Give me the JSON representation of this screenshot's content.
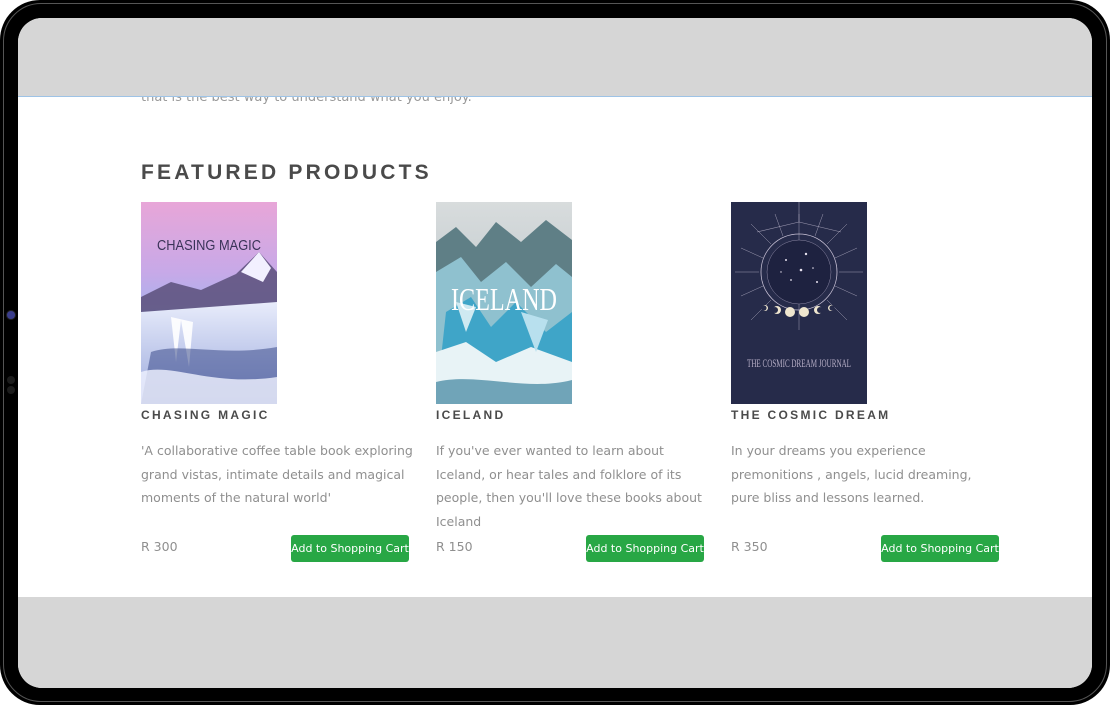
{
  "intro_text": "that is the best way to understand what you enjoy.",
  "section_title": "FEATURED PRODUCTS",
  "colors": {
    "button": "#28a745",
    "title": "#4a4a4a",
    "muted": "#8f8f8f"
  },
  "products": [
    {
      "title": "CHASING MAGIC",
      "cover_text": "CHASING MAGIC",
      "description": "'A collaborative coffee table book exploring grand vistas, intimate details and magical moments of the natural world'",
      "price": "R 300",
      "button": "Add to Shopping Cart"
    },
    {
      "title": "ICELAND",
      "cover_text": "ICELAND",
      "description": "If you've ever wanted to learn about Iceland, or hear tales and folklore of its people, then you'll love these books about Iceland",
      "price": "R 150",
      "button": "Add to Shopping Cart"
    },
    {
      "title": "THE COSMIC DREAM",
      "cover_text": "THE COSMIC DREAM JOURNAL",
      "description": "In your dreams you experience premonitions , angels, lucid dreaming, pure bliss and lessons learned.",
      "price": "R 350",
      "button": "Add to Shopping Cart"
    }
  ]
}
